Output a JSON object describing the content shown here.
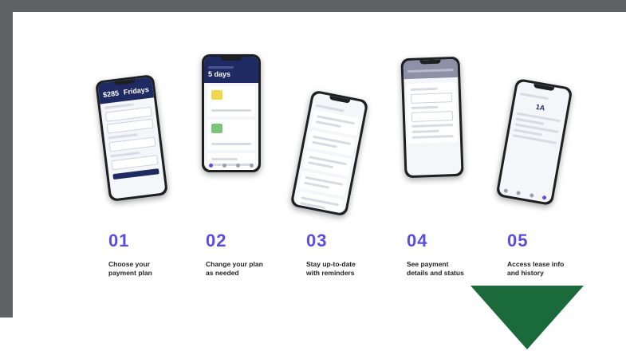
{
  "colors": {
    "frame": "#5f6163",
    "accent": "#5b4de0",
    "arrow": "#1b6a3c",
    "app_header": "#1f2a63"
  },
  "phones": [
    {
      "amount": "$285",
      "day": "Fridays"
    },
    {
      "days": "5 days"
    },
    {},
    {},
    {
      "value": "1A"
    }
  ],
  "steps": [
    {
      "number": "01",
      "label": "Choose your\npayment plan"
    },
    {
      "number": "02",
      "label": "Change your plan\nas needed"
    },
    {
      "number": "03",
      "label": "Stay up-to-date\nwith reminders"
    },
    {
      "number": "04",
      "label": "See payment\ndetails and status"
    },
    {
      "number": "05",
      "label": "Access lease info\nand history"
    }
  ],
  "icons": {
    "arrow": "down-triangle-icon"
  }
}
